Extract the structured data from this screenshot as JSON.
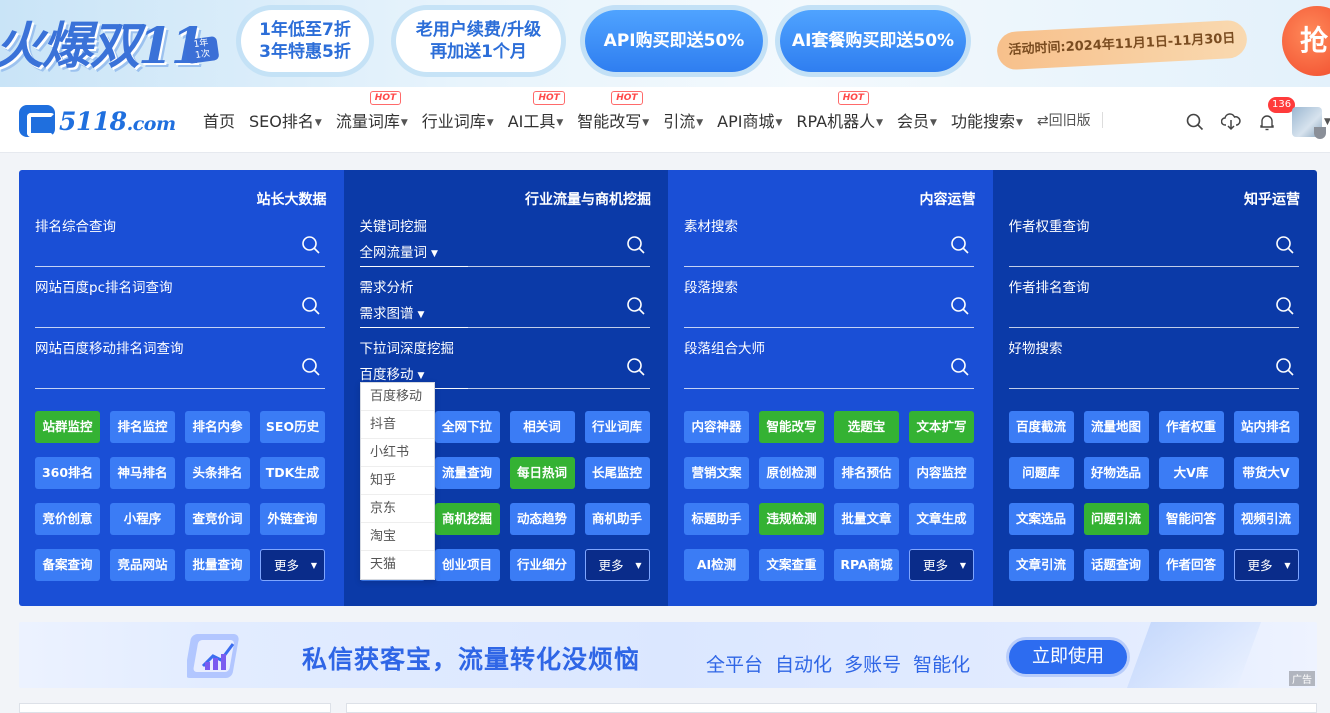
{
  "promo": {
    "logo_text": "火爆双11",
    "badge_line1": "1年",
    "badge_line2": "1次",
    "pill1_line1": "1年低至7折",
    "pill1_line2": "3年特惠5折",
    "pill2_line1": "老用户续费/升级",
    "pill2_line2": "再加送1个月",
    "pill3": "API购买即送50%",
    "pill4": "AI套餐购买即送50%",
    "date": "活动时间:2024年11月1日-11月30日",
    "grab": "抢"
  },
  "nav": {
    "logo": "5118",
    "logo_suffix": ".com",
    "items": [
      {
        "label": "首页",
        "caret": false,
        "hot": false
      },
      {
        "label": "SEO排名",
        "caret": true,
        "hot": false
      },
      {
        "label": "流量词库",
        "caret": true,
        "hot": true
      },
      {
        "label": "行业词库",
        "caret": true,
        "hot": false
      },
      {
        "label": "AI工具",
        "caret": true,
        "hot": true
      },
      {
        "label": "智能改写",
        "caret": true,
        "hot": true
      },
      {
        "label": "引流",
        "caret": true,
        "hot": false
      },
      {
        "label": "API商城",
        "caret": true,
        "hot": false
      },
      {
        "label": "RPA机器人",
        "caret": true,
        "hot": true
      },
      {
        "label": "会员",
        "caret": true,
        "hot": false
      },
      {
        "label": "功能搜索",
        "caret": true,
        "hot": false
      }
    ],
    "hot_label": "HOT",
    "old_version": "⇄回旧版",
    "notification_count": "136"
  },
  "tools": {
    "columns": [
      {
        "title": "站长大数据",
        "queries": [
          {
            "label": "排名综合查询",
            "select": ""
          },
          {
            "label": "网站百度pc排名词查询",
            "select": ""
          },
          {
            "label": "网站百度移动排名词查询",
            "select": ""
          }
        ],
        "buttons": [
          {
            "label": "站群监控",
            "green": true
          },
          {
            "label": "排名监控",
            "green": false
          },
          {
            "label": "排名内参",
            "green": false
          },
          {
            "label": "SEO历史",
            "green": false
          },
          {
            "label": "360排名",
            "green": false
          },
          {
            "label": "神马排名",
            "green": false
          },
          {
            "label": "头条排名",
            "green": false
          },
          {
            "label": "TDK生成",
            "green": false
          },
          {
            "label": "竞价创意",
            "green": false
          },
          {
            "label": "小程序",
            "green": false
          },
          {
            "label": "查竞价词",
            "green": false
          },
          {
            "label": "外链查询",
            "green": false
          },
          {
            "label": "备案查询",
            "green": false
          },
          {
            "label": "竞品网站",
            "green": false
          },
          {
            "label": "批量查询",
            "green": false
          }
        ]
      },
      {
        "title": "行业流量与商机挖掘",
        "queries": [
          {
            "label": "关键词挖掘",
            "select": "全网流量词"
          },
          {
            "label": "需求分析",
            "select": "需求图谱"
          },
          {
            "label": "下拉词深度挖掘",
            "select": "百度移动"
          }
        ],
        "buttons": [
          {
            "label": "",
            "green": false
          },
          {
            "label": "全网下拉",
            "green": false
          },
          {
            "label": "相关词",
            "green": false
          },
          {
            "label": "行业词库",
            "green": false
          },
          {
            "label": "",
            "green": false
          },
          {
            "label": "流量查询",
            "green": false
          },
          {
            "label": "每日热词",
            "green": true
          },
          {
            "label": "长尾监控",
            "green": false
          },
          {
            "label": "",
            "green": false
          },
          {
            "label": "商机挖掘",
            "green": true
          },
          {
            "label": "动态趋势",
            "green": false
          },
          {
            "label": "商机助手",
            "green": false
          },
          {
            "label": "",
            "green": false
          },
          {
            "label": "创业项目",
            "green": false
          },
          {
            "label": "行业细分",
            "green": false
          }
        ]
      },
      {
        "title": "内容运营",
        "queries": [
          {
            "label": "素材搜索",
            "select": ""
          },
          {
            "label": "段落搜索",
            "select": ""
          },
          {
            "label": "段落组合大师",
            "select": ""
          }
        ],
        "buttons": [
          {
            "label": "内容神器",
            "green": false
          },
          {
            "label": "智能改写",
            "green": true
          },
          {
            "label": "选题宝",
            "green": true
          },
          {
            "label": "文本扩写",
            "green": true
          },
          {
            "label": "营销文案",
            "green": false
          },
          {
            "label": "原创检测",
            "green": false
          },
          {
            "label": "排名预估",
            "green": false
          },
          {
            "label": "内容监控",
            "green": false
          },
          {
            "label": "标题助手",
            "green": false
          },
          {
            "label": "违规检测",
            "green": true
          },
          {
            "label": "批量文章",
            "green": false
          },
          {
            "label": "文章生成",
            "green": false
          },
          {
            "label": "AI检测",
            "green": false
          },
          {
            "label": "文案查重",
            "green": false
          },
          {
            "label": "RPA商城",
            "green": false
          }
        ]
      },
      {
        "title": "知乎运营",
        "queries": [
          {
            "label": "作者权重查询",
            "select": ""
          },
          {
            "label": "作者排名查询",
            "select": ""
          },
          {
            "label": "好物搜索",
            "select": ""
          }
        ],
        "buttons": [
          {
            "label": "百度截流",
            "green": false
          },
          {
            "label": "流量地图",
            "green": false
          },
          {
            "label": "作者权重",
            "green": false
          },
          {
            "label": "站内排名",
            "green": false
          },
          {
            "label": "问题库",
            "green": false
          },
          {
            "label": "好物选品",
            "green": false
          },
          {
            "label": "大V库",
            "green": false
          },
          {
            "label": "带货大V",
            "green": false
          },
          {
            "label": "文案选品",
            "green": false
          },
          {
            "label": "问题引流",
            "green": true
          },
          {
            "label": "智能问答",
            "green": false
          },
          {
            "label": "视频引流",
            "green": false
          },
          {
            "label": "文章引流",
            "green": false
          },
          {
            "label": "话题查询",
            "green": false
          },
          {
            "label": "作者回答",
            "green": false
          }
        ]
      }
    ],
    "more_label": "更多",
    "dropdown_options": [
      "百度移动",
      "抖音",
      "小红书",
      "知乎",
      "京东",
      "淘宝",
      "天猫"
    ]
  },
  "ad": {
    "title": "私信获客宝，流量转化没烦恼",
    "subtitle": "全平台 自动化 多账号 智能化",
    "button": "立即使用",
    "tag": "广告"
  },
  "colors": {
    "primary": "#1a4fd6",
    "dark_column": "#0b3aa8",
    "button_blue": "#3b7cf5",
    "button_green": "#34b233",
    "hot_red": "#ff4a4a"
  }
}
